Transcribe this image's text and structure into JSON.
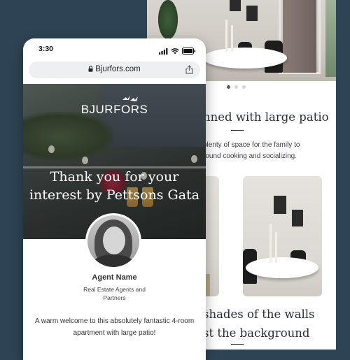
{
  "back_screen": {
    "heading_fragment": "nned with large patio",
    "body_lines": [
      "plenty of space for the family to",
      "round cooking and socializing."
    ],
    "heading2_lines": [
      "shades of the walls",
      "st the background"
    ],
    "carousel_dots": 3,
    "carousel_active": 0,
    "photo_badge_icon": "image-icon"
  },
  "front_screen": {
    "status_time": "3:30",
    "status_icons": [
      "signal-icon",
      "wifi-icon",
      "battery-icon"
    ],
    "url": "Bjurfors.com",
    "brand_logo": "BJURFORS",
    "hero_title_lines": [
      "Thank you for your",
      "interest by Pettsons Gata"
    ],
    "agent_name": "Agent Name",
    "agent_role_lines": [
      "Real Estate Agents and",
      "Partners"
    ],
    "welcome_lines": [
      "A warm welcome to this absolutely fantastic 4-room",
      "apartment with large patio!"
    ]
  },
  "colors": {
    "background": "#2e4354",
    "text_dark": "#2a2f35",
    "active_dot": "#4a5a6a",
    "url_bar": "#eeeff1"
  }
}
